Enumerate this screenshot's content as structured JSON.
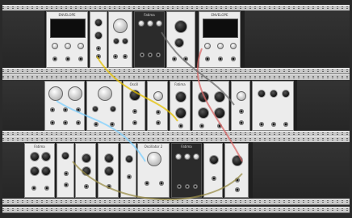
{
  "rack": {
    "module_labels": [
      {
        "id": "m_1_1",
        "text": "ENVELOPE"
      },
      {
        "id": "m_1_3",
        "text": "Fatima"
      },
      {
        "id": "m_1_4",
        "text": "ENVELOPE"
      },
      {
        "id": "m_2_2",
        "text": "Oscill"
      },
      {
        "id": "m_2_3",
        "text": "Fatima"
      },
      {
        "id": "m_3_1",
        "text": "Fatima"
      },
      {
        "id": "m_3_2",
        "text": "Oscillator 2"
      },
      {
        "id": "m_3_3",
        "text": "Fatima"
      }
    ]
  },
  "colors": {
    "rack_bg": "#2a2a2a",
    "rail": "#c9c9c9",
    "panel_light": "#ececec",
    "panel_dark": "#2b2b2b",
    "scope_trace": "#00a3c7",
    "cables": [
      "#e6c200",
      "#7fd0ff",
      "#d96a6a",
      "#9b8f4a",
      "#6b6b6b"
    ]
  }
}
